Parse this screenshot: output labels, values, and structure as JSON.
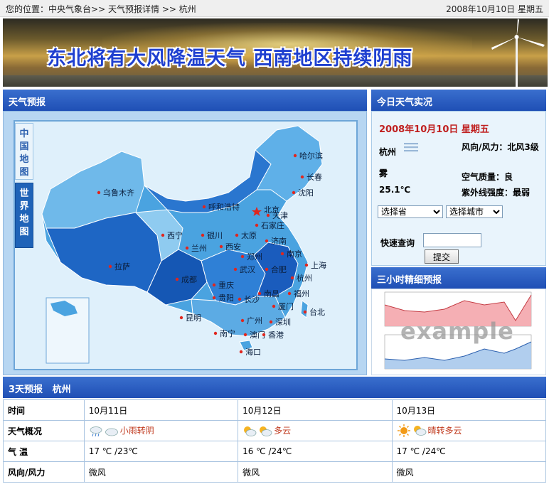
{
  "breadcrumb": {
    "prefix": "您的位置：",
    "items": [
      "中央气象台",
      "天气预报详情",
      "杭州"
    ],
    "separator": ">>"
  },
  "header_date": "2008年10月10日 星期五",
  "banner": {
    "headline": "东北将有大风降温天气  西南地区持续阴雨"
  },
  "forecast_panel": {
    "title": "天气预报",
    "tabs": [
      "中国地图",
      "世界地图"
    ],
    "cities": [
      {
        "name": "哈尔滨"
      },
      {
        "name": "长春"
      },
      {
        "name": "沈阳"
      },
      {
        "name": "乌鲁木齐"
      },
      {
        "name": "呼和浩特"
      },
      {
        "name": "北京"
      },
      {
        "name": "天津"
      },
      {
        "name": "石家庄"
      },
      {
        "name": "西宁"
      },
      {
        "name": "银川"
      },
      {
        "name": "太原"
      },
      {
        "name": "济南"
      },
      {
        "name": "兰州"
      },
      {
        "name": "西安"
      },
      {
        "name": "郑州"
      },
      {
        "name": "南京"
      },
      {
        "name": "合肥"
      },
      {
        "name": "上海"
      },
      {
        "name": "拉萨"
      },
      {
        "name": "成都"
      },
      {
        "name": "武汉"
      },
      {
        "name": "杭州"
      },
      {
        "name": "重庆"
      },
      {
        "name": "南昌"
      },
      {
        "name": "福州"
      },
      {
        "name": "贵阳"
      },
      {
        "name": "长沙"
      },
      {
        "name": "厦门"
      },
      {
        "name": "台北"
      },
      {
        "name": "昆明"
      },
      {
        "name": "广州"
      },
      {
        "name": "深圳"
      },
      {
        "name": "南宁"
      },
      {
        "name": "澳门"
      },
      {
        "name": "香港"
      },
      {
        "name": "海口"
      }
    ]
  },
  "today": {
    "title": "今日天气实况",
    "date": "2008年10月10日 星期五",
    "city": "杭州",
    "condition": "雾",
    "temperature": "25.1℃",
    "wind": "风向/风力：北风3级",
    "air": "空气质量：良",
    "uv": "紫外线强度：最弱",
    "province_select": "选择省",
    "city_select": "选择城市",
    "quick_label": "快速查询",
    "submit": "提交",
    "icon": "fog-icon"
  },
  "three_hour": {
    "title": "三小时精细预报",
    "watermark": "example"
  },
  "three_day": {
    "title": "3天预报",
    "city": "杭州",
    "rows": [
      {
        "label": "时间",
        "cells": [
          "10月11日",
          "10月12日",
          "10月13日"
        ]
      },
      {
        "label": "天气概况",
        "cells": [
          "小雨转阴",
          "多云",
          "晴转多云"
        ],
        "icons": [
          [
            "rain-icon",
            "cloud-icon"
          ],
          [
            "cloud-sun-icon",
            "cloud-sun-icon"
          ],
          [
            "sun-icon",
            "cloud-sun-icon"
          ]
        ]
      },
      {
        "label": "气 温",
        "cells": [
          "17 ℃ /23℃",
          "16 ℃ /24℃",
          "17 ℃ /24℃"
        ]
      },
      {
        "label": "风向/风力",
        "cells": [
          "微风",
          "微风",
          "微风"
        ]
      }
    ]
  },
  "colors": {
    "panel_header": "#1f4fb5",
    "alert_text": "#c02020",
    "weather_text": "#c0391d"
  }
}
